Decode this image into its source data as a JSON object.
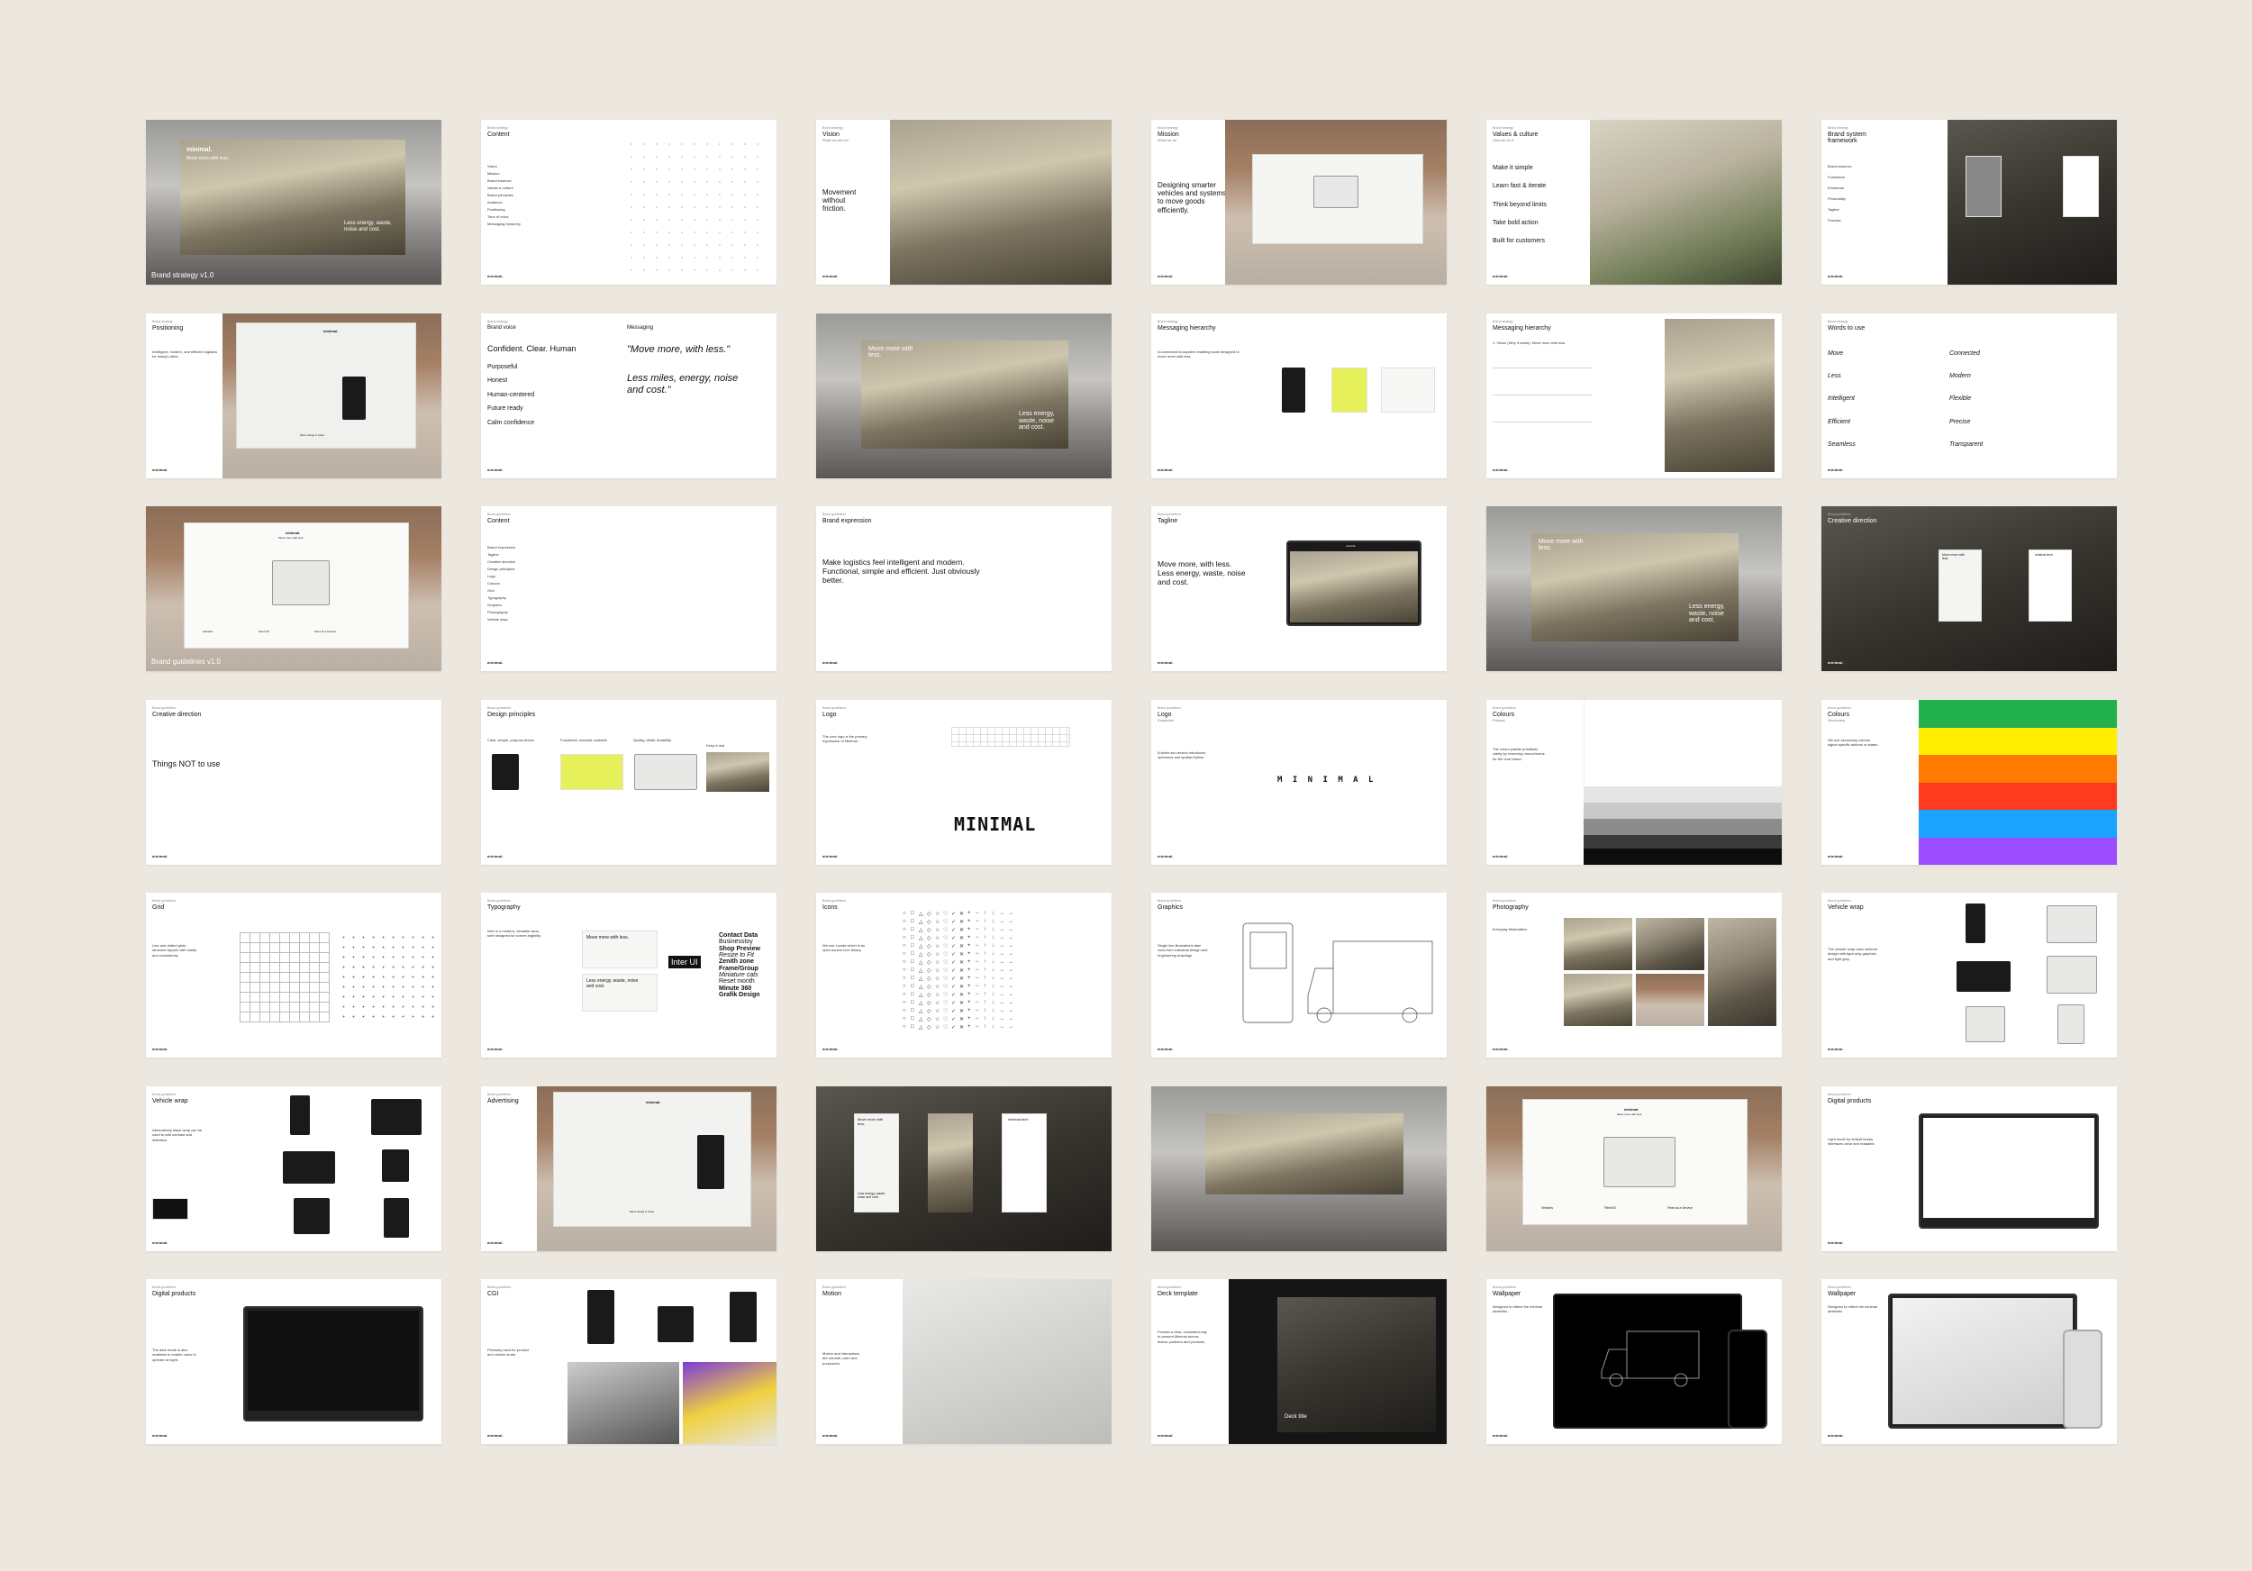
{
  "page": {
    "background": "#ece8df"
  },
  "slides": [
    {
      "title": "",
      "cover_title": "minimal.",
      "cover_sub": "Move more with less.",
      "caption": "Brand strategy v1.0",
      "overlay": "Less energy, waste, noise and cost."
    },
    {
      "header": "Brand strategy",
      "title": "Content",
      "items": [
        "Vision",
        "Mission",
        "Brand essence",
        "Values & culture",
        "Brand principles",
        "Audience",
        "Positioning",
        "Tone of voice",
        "Messaging hierarchy"
      ],
      "foot": "minimal."
    },
    {
      "header": "Brand strategy",
      "title": "Vision",
      "subtitle": "What we aim for",
      "big": "Movement without friction.",
      "foot": "minimal."
    },
    {
      "header": "Brand strategy",
      "title": "Mission",
      "subtitle": "What we do",
      "big": "Designing smarter vehicles and systems to move goods efficiently.",
      "foot": "minimal."
    },
    {
      "header": "Brand strategy",
      "title": "Values & culture",
      "subtitle": "How we do it",
      "items": [
        "Make it simple",
        "Learn fast & iterate",
        "Think beyond limits",
        "Take bold action",
        "Built for customers"
      ],
      "foot": "minimal."
    },
    {
      "header": "Brand strategy",
      "title": "Brand system framework",
      "rows": [
        "Brand essence",
        "Functional",
        "Emotional",
        "Personality",
        "Tagline",
        "Promise"
      ],
      "foot": "minimal."
    },
    {
      "header": "Brand strategy",
      "title": "Positioning",
      "body": "Intelligent, modern, and efficient logistics for today's cities.",
      "foot": "minimal.",
      "bill_logo": "minimal.",
      "bill_caption": "Move things in cities"
    },
    {
      "header": "Brand strategy",
      "title": "Brand voice",
      "items": [
        "Confident. Clear. Human",
        "Purposeful",
        "Honest",
        "Human-centered",
        "Future ready",
        "Calm confidence"
      ],
      "col2_title": "Messaging",
      "quote1": "\"Move more, with less.\"",
      "quote2": "Less miles, energy, noise and cost.\"",
      "foot": "minimal."
    },
    {
      "overlay1": "Move more with less.",
      "overlay2": "Less energy, waste, noise and cost."
    },
    {
      "header": "Brand strategy",
      "title": "Messaging hierarchy",
      "body": "A connected ecosystem enabling scale designed to move more with less.",
      "foot": "minimal."
    },
    {
      "header": "Brand strategy",
      "title": "Messaging hierarchy",
      "body": "1. Vision (Why it exists): Move more with less.",
      "foot": "minimal."
    },
    {
      "header": "Brand strategy",
      "title": "Words to use",
      "words_left": [
        "Move",
        "Less",
        "Intelligent",
        "Efficient",
        "Seamless"
      ],
      "words_right": [
        "Connected",
        "Modern",
        "Flexible",
        "Precise",
        "Transparent"
      ],
      "foot": "minimal."
    },
    {
      "cover_title": "minimal.",
      "cover_sub": "Move more with less.",
      "caption": "Brand guidelines v1.0",
      "bill_cols": [
        "Vehicles",
        "Fleet OS",
        "Fleet as a Service"
      ]
    },
    {
      "header": "Brand guidelines",
      "title": "Content",
      "items": [
        "Brand expression",
        "Tagline",
        "Creative direction",
        "Design principles",
        "Logo",
        "Colours",
        "Grid",
        "Typography",
        "Graphics",
        "Photography",
        "Vehicle wrap"
      ],
      "foot": "minimal."
    },
    {
      "header": "Brand guidelines",
      "title": "Brand expression",
      "big": "Make logistics feel intelligent and modern. Functional, simple and efficient. Just obviously better.",
      "foot": "minimal."
    },
    {
      "header": "Brand guidelines",
      "title": "Tagline",
      "big": "Move more, with less. Less energy, waste, noise and cost.",
      "foot": "minimal.",
      "screen_logo": "minimal."
    },
    {
      "overlay1": "Move more with less.",
      "overlay2": "Less energy, waste, noise and cost."
    },
    {
      "header": "Brand guidelines",
      "title": "Creative direction",
      "poster1": "Move more with less.",
      "poster2": "minimal.tech",
      "foot": "minimal."
    },
    {
      "header": "Brand guidelines",
      "title": "Creative direction",
      "big": "Things NOT to use",
      "foot": "minimal."
    },
    {
      "header": "Brand guidelines",
      "title": "Design principles",
      "cols": [
        "Clear, simple, purpose-driven",
        "Functional, modular, scalable",
        "Quality, detail, durability",
        "Keep it real"
      ],
      "foot": "minimal."
    },
    {
      "header": "Brand guidelines",
      "title": "Logo",
      "body": "The core logo is the primary expression of Minimal.",
      "logo": "MINIMAL",
      "foot": "minimal."
    },
    {
      "header": "Brand guidelines",
      "title": "Logo",
      "subtitle": "Expanded",
      "body": "A wider-set version introduces openness and spatial rhythm.",
      "logo": "M I N I M A L",
      "foot": "minimal."
    },
    {
      "header": "Brand guidelines",
      "title": "Colours",
      "subtitle": "Primary",
      "body": "The colour palette prioritises clarity by reserving monochrome for the core brand.",
      "foot": "minimal."
    },
    {
      "header": "Brand guidelines",
      "title": "Colours",
      "subtitle": "Secondary",
      "body": "We use secondary colours signal specific actions or states.",
      "colors": [
        "#22b14c",
        "#ffee00",
        "#ff7a00",
        "#ff3b1f",
        "#1aa3ff",
        "#9b4dff"
      ],
      "foot": "minimal."
    },
    {
      "header": "Brand guidelines",
      "title": "Grid",
      "body": "Line and dotted grids structure layouts with clarity and consistency.",
      "foot": "minimal."
    },
    {
      "header": "Brand guidelines",
      "title": "Typography",
      "body": "Inter is a modern, versatile sans-serif designed for screen legibility.",
      "sample1": "Move more with less.",
      "sample2": "Less energy, waste, noise and cost.",
      "font_name": "Inter UI",
      "specimen": [
        "Contact Data",
        "Businesstoy",
        "Shop Preview",
        "Resize to Fit",
        "Zenith zone",
        "Frame/Group",
        "Miniature cats",
        "Reset month",
        "Minute 360",
        "Grafik Design"
      ],
      "foot": "minimal."
    },
    {
      "header": "Brand guidelines",
      "title": "Icons",
      "body": "We use Lucide which is an open-source icon library.",
      "foot": "minimal."
    },
    {
      "header": "Brand guidelines",
      "title": "Graphics",
      "body": "Single line illustrations take cues from industrial design and engineering drawings.",
      "foot": "minimal."
    },
    {
      "header": "Brand guidelines",
      "title": "Photography",
      "body": "Everyday Minimalism",
      "foot": "minimal."
    },
    {
      "header": "Brand guidelines",
      "title": "Vehicle wrap",
      "body": "The vehicle wrap uses minimal design with type-only graphics and light grey.",
      "foot": "minimal."
    },
    {
      "header": "Brand guidelines",
      "title": "Vehicle wrap",
      "body": "Alternatively black wrap can be used to add contrast and definition.",
      "foot": "minimal."
    },
    {
      "header": "Brand guidelines",
      "title": "Advertising",
      "bill_logo": "minimal.",
      "bill_caption": "Move things in cities",
      "foot": "minimal."
    },
    {
      "poster1": "Move more with less.",
      "poster1b": "Less energy, waste, noise and cost.",
      "poster2": "minimal.tech"
    },
    {
      "title": ""
    },
    {
      "cover_title": "minimal.",
      "cover_sub": "Move more with less.",
      "bill_cols": [
        "Vehicles",
        "FleetOS",
        "Fleet as a Service"
      ]
    },
    {
      "header": "Brand guidelines",
      "title": "Digital products",
      "body": "Light mode by default keeps interfaces clear and readable.",
      "foot": "minimal."
    },
    {
      "header": "Brand guidelines",
      "title": "Digital products",
      "body": "The dark mode is also available to enable users to operate at night.",
      "foot": "minimal."
    },
    {
      "header": "Brand guidelines",
      "title": "CGI",
      "body": "Precisely used for product and vehicle shots.",
      "foot": "minimal."
    },
    {
      "header": "Brand guidelines",
      "title": "Motion",
      "body": "Motion and interactions are smooth, calm and purposeful.",
      "foot": "minimal."
    },
    {
      "header": "Brand guidelines",
      "title": "Deck template",
      "body": "Provide a clear, consistent way to present Minimal across teams, partners and products.",
      "deck_label": "Deck title",
      "foot": "minimal."
    },
    {
      "header": "Brand guidelines",
      "title": "Wallpaper",
      "body": "Designed to reflect the minimal aesthetic.",
      "foot": "minimal."
    },
    {
      "header": "Brand guidelines",
      "title": "Wallpaper",
      "body": "Designed to reflect the minimal aesthetic.",
      "foot": "minimal."
    }
  ]
}
